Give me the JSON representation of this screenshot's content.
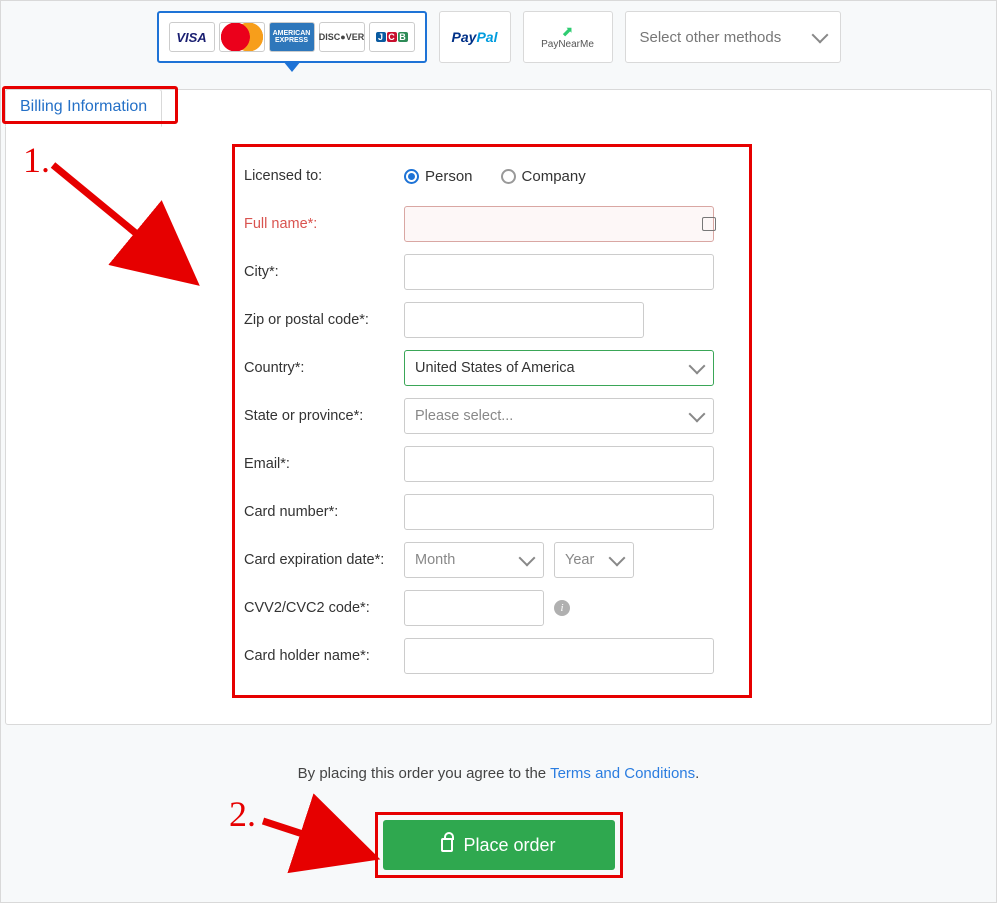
{
  "payment_methods": {
    "cards": [
      "VISA",
      "mastercard",
      "AMERICAN EXPRESS",
      "DISCOVER",
      "JCB"
    ],
    "paypal": "PayPal",
    "paynearme": "PayNearMe",
    "other_label": "Select other methods"
  },
  "section_title": "Billing Information",
  "form": {
    "licensed_label": "Licensed to:",
    "licensed_person": "Person",
    "licensed_company": "Company",
    "fullname_label": "Full name*:",
    "city_label": "City*:",
    "zip_label": "Zip or postal code*:",
    "country_label": "Country*:",
    "country_value": "United States of America",
    "state_label": "State or province*:",
    "state_placeholder": "Please select...",
    "email_label": "Email*:",
    "cardno_label": "Card number*:",
    "exp_label": "Card expiration date*:",
    "exp_month_placeholder": "Month",
    "exp_year_placeholder": "Year",
    "cvv_label": "CVV2/CVC2 code*:",
    "holder_label": "Card holder name*:"
  },
  "agree_prefix": "By placing this order you agree to the ",
  "agree_link": "Terms and Conditions",
  "agree_suffix": ".",
  "place_button": "Place order",
  "annotations": {
    "step1": "1.",
    "step2": "2."
  }
}
